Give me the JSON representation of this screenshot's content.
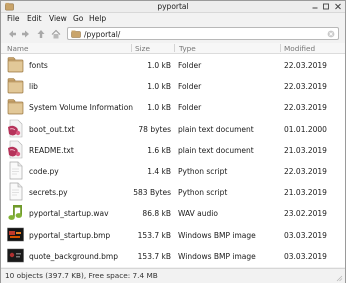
{
  "window": {
    "title": "pyportal"
  },
  "menu": [
    "File",
    "Edit",
    "View",
    "Go",
    "Help"
  ],
  "path": {
    "value": "/pyportal/"
  },
  "columns": {
    "name": "Name",
    "size": "Size",
    "type": "Type",
    "modified": "Modified"
  },
  "files": [
    {
      "name": "fonts",
      "size": "1.0 kB",
      "type": "Folder",
      "modified": "22.03.2019",
      "icon": "folder-icon"
    },
    {
      "name": "lib",
      "size": "1.0 kB",
      "type": "Folder",
      "modified": "22.03.2019",
      "icon": "folder-icon"
    },
    {
      "name": "System Volume Information",
      "size": "1.0 kB",
      "type": "Folder",
      "modified": "22.03.2019",
      "icon": "folder-icon"
    },
    {
      "name": "boot_out.txt",
      "size": "78 bytes",
      "type": "plain text document",
      "modified": "01.01.2000",
      "icon": "text-document-icon"
    },
    {
      "name": "README.txt",
      "size": "1.6 kB",
      "type": "plain text document",
      "modified": "21.03.2019",
      "icon": "text-document-icon"
    },
    {
      "name": "code.py",
      "size": "1.4 kB",
      "type": "Python script",
      "modified": "22.03.2019",
      "icon": "python-script-icon"
    },
    {
      "name": "secrets.py",
      "size": "583 Bytes",
      "type": "Python script",
      "modified": "21.03.2019",
      "icon": "python-script-icon"
    },
    {
      "name": "pyportal_startup.wav",
      "size": "86.8 kB",
      "type": "WAV audio",
      "modified": "23.02.2019",
      "icon": "audio-file-icon"
    },
    {
      "name": "pyportal_startup.bmp",
      "size": "153.7 kB",
      "type": "Windows BMP image",
      "modified": "03.03.2019",
      "icon": "image-file-icon"
    },
    {
      "name": "quote_background.bmp",
      "size": "153.7 kB",
      "type": "Windows BMP image",
      "modified": "03.03.2019",
      "icon": "image-file-icon"
    }
  ],
  "status": {
    "text": "10 objects (397.7 KB), Free space: 7.4 MB"
  }
}
